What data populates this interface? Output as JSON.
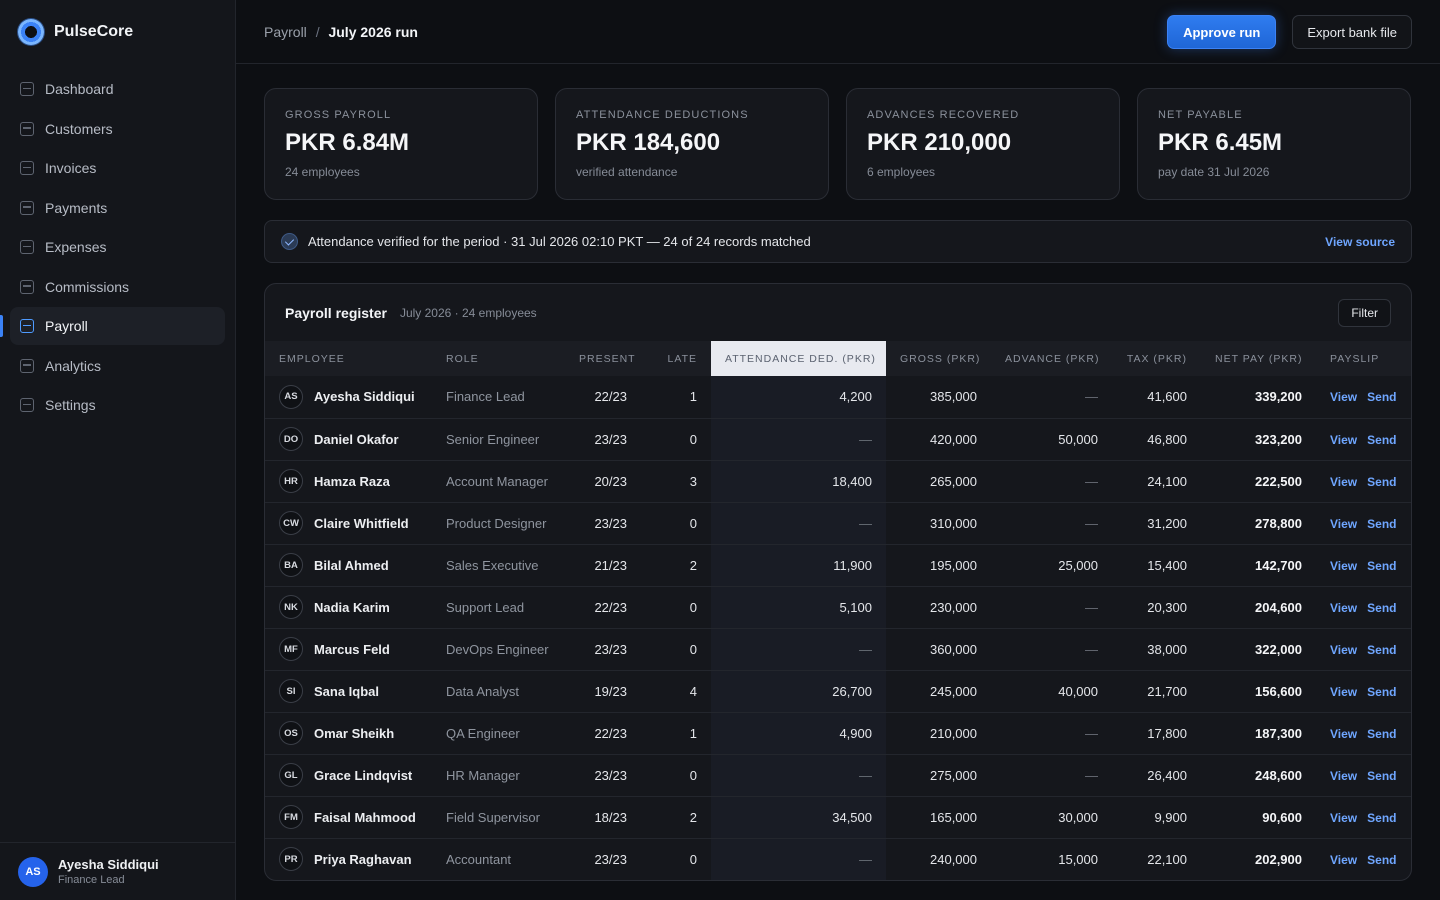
{
  "app": {
    "name": "PulseCore"
  },
  "sidebar": {
    "items": [
      {
        "id": "dashboard",
        "label": "Dashboard",
        "icon": "dashboard-icon"
      },
      {
        "id": "customers",
        "label": "Customers",
        "icon": "customers-icon"
      },
      {
        "id": "invoices",
        "label": "Invoices",
        "icon": "invoices-icon"
      },
      {
        "id": "payments",
        "label": "Payments",
        "icon": "payments-icon"
      },
      {
        "id": "expenses",
        "label": "Expenses",
        "icon": "expenses-icon"
      },
      {
        "id": "commissions",
        "label": "Commissions",
        "icon": "commissions-icon"
      },
      {
        "id": "payroll",
        "label": "Payroll",
        "icon": "payroll-icon",
        "active": true
      },
      {
        "id": "analytics",
        "label": "Analytics",
        "icon": "analytics-icon"
      },
      {
        "id": "settings",
        "label": "Settings",
        "icon": "settings-icon"
      }
    ]
  },
  "user": {
    "initials": "AS",
    "name": "Ayesha Siddiqui",
    "role": "Finance Lead"
  },
  "header": {
    "breadcrumb_parent": "Payroll",
    "breadcrumb_sep": "/",
    "breadcrumb_current": "July 2026 run",
    "approve_label": "Approve run",
    "export_label": "Export bank file"
  },
  "kpis": [
    {
      "label": "GROSS PAYROLL",
      "value": "PKR 6.84M",
      "sub": "24 employees"
    },
    {
      "label": "ATTENDANCE DEDUCTIONS",
      "value": "PKR 184,600",
      "sub": "verified attendance"
    },
    {
      "label": "ADVANCES RECOVERED",
      "value": "PKR 210,000",
      "sub": "6 employees"
    },
    {
      "label": "NET PAYABLE",
      "value": "PKR 6.45M",
      "sub": "pay date 31 Jul 2026"
    }
  ],
  "banner": {
    "text": "Attendance verified for the period · 31 Jul 2026 02:10 PKT — 24 of 24 records matched",
    "link": "View source"
  },
  "register": {
    "title": "Payroll register",
    "meta": "July 2026 · 24 employees",
    "filter_label": "Filter",
    "columns": [
      "EMPLOYEE",
      "ROLE",
      "PRESENT",
      "LATE",
      "ATTENDANCE DED. (PKR)",
      "GROSS (PKR)",
      "ADVANCE (PKR)",
      "TAX (PKR)",
      "NET PAY (PKR)",
      "PAYSLIP"
    ],
    "view_label": "View",
    "send_label": "Send",
    "rows": [
      {
        "initials": "AS",
        "name": "Ayesha Siddiqui",
        "role": "Finance Lead",
        "present": "22/23",
        "late": "1",
        "att": "4,200",
        "gross": "385,000",
        "adv": "—",
        "tax": "41,600",
        "net": "339,200"
      },
      {
        "initials": "DO",
        "name": "Daniel Okafor",
        "role": "Senior Engineer",
        "present": "23/23",
        "late": "0",
        "att": "—",
        "gross": "420,000",
        "adv": "50,000",
        "tax": "46,800",
        "net": "323,200"
      },
      {
        "initials": "HR",
        "name": "Hamza Raza",
        "role": "Account Manager",
        "present": "20/23",
        "late": "3",
        "att": "18,400",
        "gross": "265,000",
        "adv": "—",
        "tax": "24,100",
        "net": "222,500"
      },
      {
        "initials": "CW",
        "name": "Claire Whitfield",
        "role": "Product Designer",
        "present": "23/23",
        "late": "0",
        "att": "—",
        "gross": "310,000",
        "adv": "—",
        "tax": "31,200",
        "net": "278,800"
      },
      {
        "initials": "BA",
        "name": "Bilal Ahmed",
        "role": "Sales Executive",
        "present": "21/23",
        "late": "2",
        "att": "11,900",
        "gross": "195,000",
        "adv": "25,000",
        "tax": "15,400",
        "net": "142,700"
      },
      {
        "initials": "NK",
        "name": "Nadia Karim",
        "role": "Support Lead",
        "present": "22/23",
        "late": "0",
        "att": "5,100",
        "gross": "230,000",
        "adv": "—",
        "tax": "20,300",
        "net": "204,600"
      },
      {
        "initials": "MF",
        "name": "Marcus Feld",
        "role": "DevOps Engineer",
        "present": "23/23",
        "late": "0",
        "att": "—",
        "gross": "360,000",
        "adv": "—",
        "tax": "38,000",
        "net": "322,000"
      },
      {
        "initials": "SI",
        "name": "Sana Iqbal",
        "role": "Data Analyst",
        "present": "19/23",
        "late": "4",
        "att": "26,700",
        "gross": "245,000",
        "adv": "40,000",
        "tax": "21,700",
        "net": "156,600"
      },
      {
        "initials": "OS",
        "name": "Omar Sheikh",
        "role": "QA Engineer",
        "present": "22/23",
        "late": "1",
        "att": "4,900",
        "gross": "210,000",
        "adv": "—",
        "tax": "17,800",
        "net": "187,300"
      },
      {
        "initials": "GL",
        "name": "Grace Lindqvist",
        "role": "HR Manager",
        "present": "23/23",
        "late": "0",
        "att": "—",
        "gross": "275,000",
        "adv": "—",
        "tax": "26,400",
        "net": "248,600"
      },
      {
        "initials": "FM",
        "name": "Faisal Mahmood",
        "role": "Field Supervisor",
        "present": "18/23",
        "late": "2",
        "att": "34,500",
        "gross": "165,000",
        "adv": "30,000",
        "tax": "9,900",
        "net": "90,600"
      },
      {
        "initials": "PR",
        "name": "Priya Raghavan",
        "role": "Accountant",
        "present": "23/23",
        "late": "0",
        "att": "—",
        "gross": "240,000",
        "adv": "15,000",
        "tax": "22,100",
        "net": "202,900"
      }
    ]
  }
}
